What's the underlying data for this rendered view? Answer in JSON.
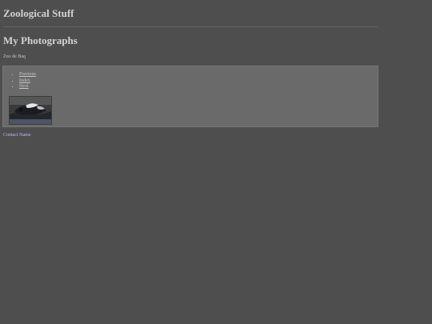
{
  "site": {
    "title": "Zoological Stuff"
  },
  "page": {
    "title": "My Photographs"
  },
  "album": {
    "name": "Zoo de Baq"
  },
  "nav": {
    "items": [
      {
        "label": "Previous"
      },
      {
        "label": "Index"
      },
      {
        "label": "Next"
      }
    ]
  },
  "footer": {
    "contact_label": "Contact Name"
  },
  "colors": {
    "background": "#4e4e4e",
    "panel": "#6a6a6a",
    "link": "#c7c7c7",
    "contact_link": "#b9b9ff"
  }
}
